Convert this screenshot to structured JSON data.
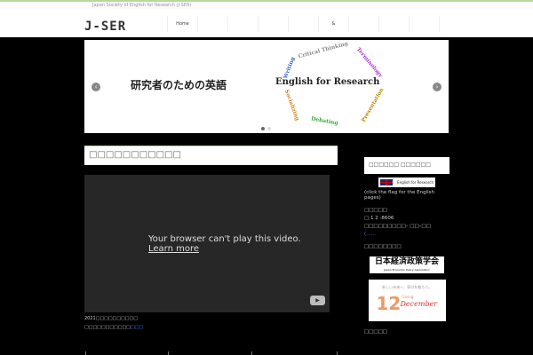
{
  "topbar": {
    "tagline": "Japan Society of English for Research (J-SER)"
  },
  "header": {
    "logo": "J-SER",
    "nav": [
      "Home",
      "",
      "",
      "",
      "",
      "&",
      "",
      "",
      "",
      ""
    ]
  },
  "banner": {
    "jp_title": "研究者のための英語",
    "en_title": "English  for  Research",
    "ring": [
      "Writing",
      "Critical Thinking",
      "Terminology",
      "Presentation",
      "Debating",
      "Socializing"
    ],
    "prev": "‹",
    "next": "›"
  },
  "main": {
    "title": "□□□□□□□□□□□",
    "video": {
      "message": "Your browser can't play this video.",
      "learn_more": "Learn more",
      "play": "▶"
    },
    "caption1": "2021□□□□□□□□□□",
    "caption2": "□□□□□□□□□□□",
    "caption2_link": "□□□"
  },
  "sidebar": {
    "title": "□□□□□□ □□□□□□",
    "flag_label": "English for Research",
    "flag_note": "(click the flag for the English pages)",
    "contact_head": "□□□□□",
    "postal": "□ 1 2 -8606",
    "address": "□□□□□□□□□– □□–□□",
    "more": "(……",
    "links_head": "□□□□□□□□",
    "jepa": "日本経済政策学会",
    "jepa_en": "Japan Economic Policy Association",
    "giving_tag": "新しい未来へ、寄付を贈ろう。",
    "giving_num": "12",
    "giving_word": "Giving",
    "giving_month": "December",
    "last_head": "□□□□□"
  }
}
